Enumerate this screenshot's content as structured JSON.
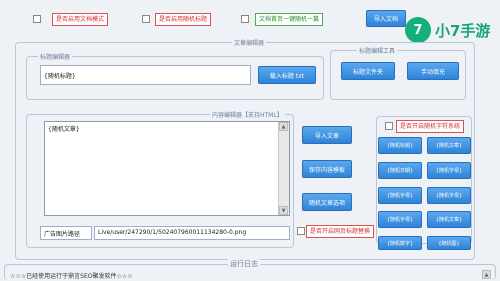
{
  "top_options": {
    "opt1": "是否启用文档模式",
    "opt2": "是否启用随机标题",
    "opt3": "文档首页一键随机一篇",
    "import_doc": "导入文档"
  },
  "logo": {
    "mark": "7",
    "text": "小7手游"
  },
  "article_editor": {
    "title": "文章编辑器",
    "title_group": "标题编辑器",
    "title_value": "{随机标题}",
    "load_title_btn": "载入标题 txt",
    "title_tools": "标题编辑工具",
    "btn_title_file": "标题文件夹",
    "btn_random_title": "手动填充"
  },
  "content_editor": {
    "title": "内容编辑器【支持HTML】",
    "content_value": "{随机文章}",
    "btn_import_article": "导入文章",
    "btn_save_template": "保存内容模板",
    "btn_article_settings": "随机文章选项",
    "label_picture_path": "广告图片路径",
    "picture_path_value": "Live/user/247290/1/502407960011134280-0.png",
    "check_keyword_replace": "是否开启网页标题替换",
    "check_random_tags": "是否开启随机字符系统",
    "tag_buttons": [
      "{随机标题}",
      "{随机文章}",
      "{随机日期}",
      "{随机字母}",
      "{随机字母}",
      "{随机字母}",
      "{随机字母}",
      "{随机文章}",
      "{随机数字}",
      "{随机图}"
    ]
  },
  "log": {
    "title": "运行日志",
    "line1": "☆☆☆已经使用运行于鼎言SEO聚发软件☆☆☆"
  }
}
